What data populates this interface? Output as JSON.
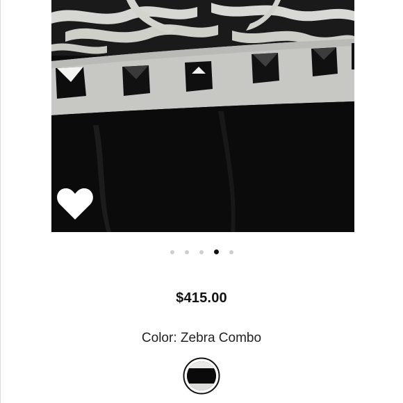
{
  "product": {
    "price": "$415.00",
    "color_label": "Color: ",
    "color_value": "Zebra Combo",
    "image_count": 5,
    "active_image": 4
  },
  "colors": {
    "accent": "#111111",
    "dot_inactive": "#cfcfcf",
    "background": "#ffffff"
  },
  "icons": {
    "favorite": "heart-icon"
  }
}
